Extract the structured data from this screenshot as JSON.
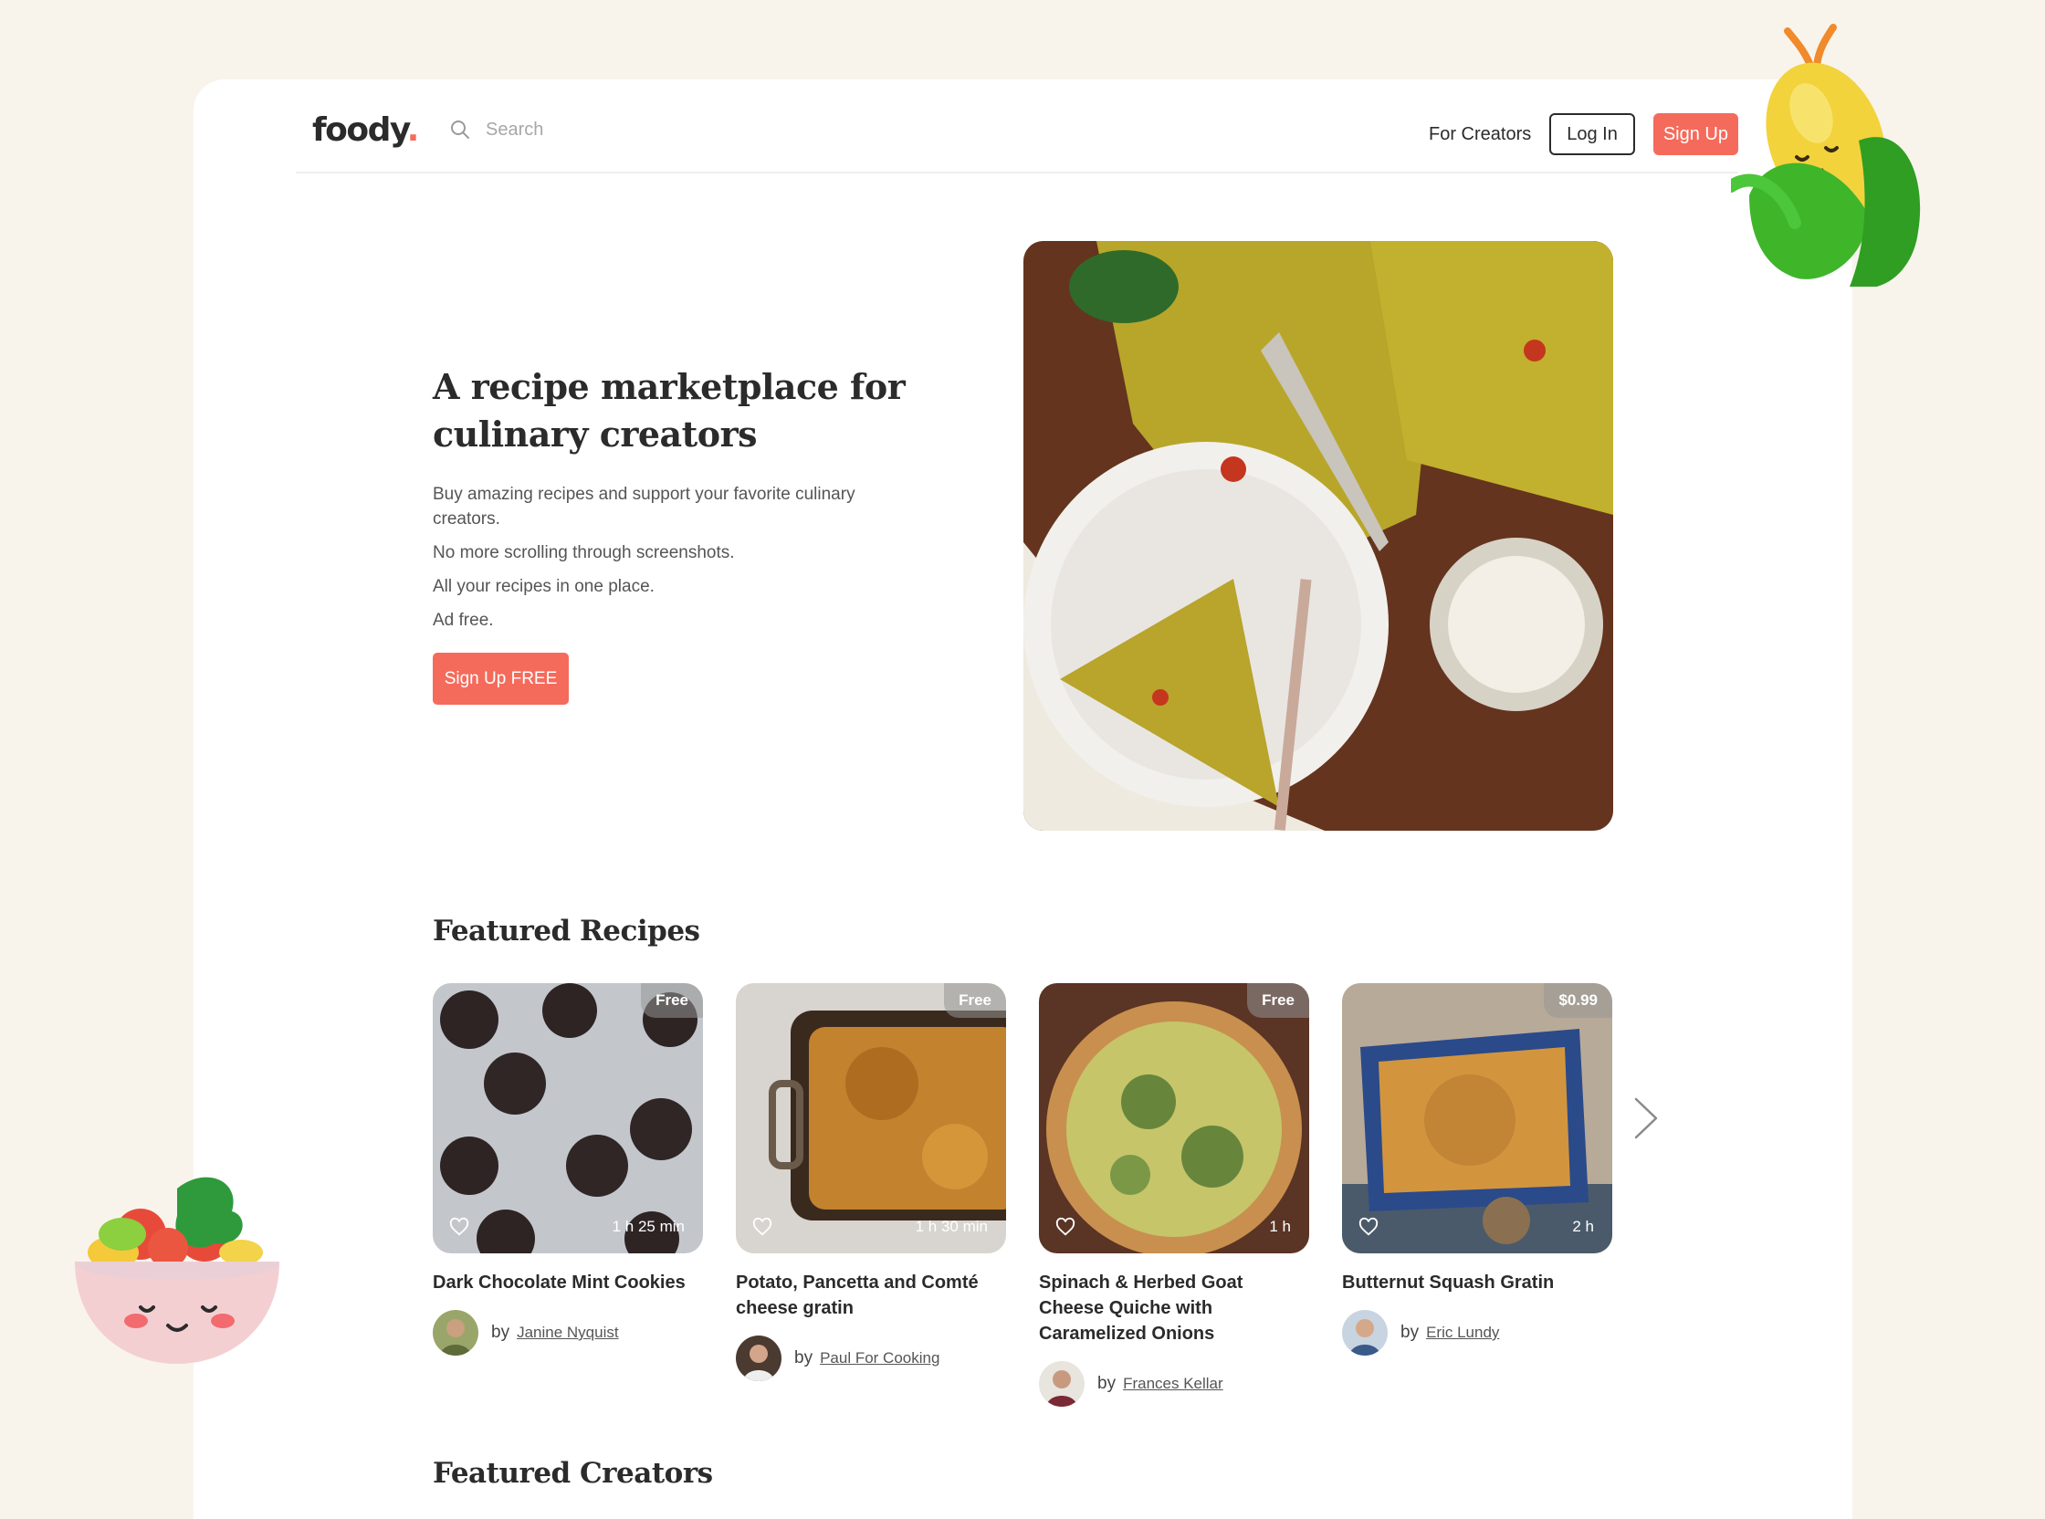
{
  "brand": {
    "name": "foody",
    "dot": "."
  },
  "header": {
    "search_placeholder": "Search",
    "for_creators": "For Creators",
    "login": "Log In",
    "signup": "Sign Up"
  },
  "hero": {
    "title": "A recipe marketplace for culinary creators",
    "lines": [
      "Buy amazing recipes and support your favorite culinary creators.",
      "No more scrolling through screenshots.",
      "All your recipes in one place.",
      "Ad free."
    ],
    "cta": "Sign Up FREE"
  },
  "featured_recipes": {
    "title": "Featured Recipes",
    "by": "by",
    "items": [
      {
        "title": "Dark Chocolate Mint Cookies",
        "price": "Free",
        "duration": "1 h 25 min",
        "author": "Janine Nyquist"
      },
      {
        "title": "Potato, Pancetta and Comté cheese gratin",
        "price": "Free",
        "duration": "1 h 30 min",
        "author": "Paul For Cooking"
      },
      {
        "title": "Spinach & Herbed Goat Cheese Quiche with Caramelized Onions",
        "price": "Free",
        "duration": "1 h",
        "author": "Frances Kellar"
      },
      {
        "title": "Butternut Squash Gratin",
        "price": "$0.99",
        "duration": "2 h",
        "author": "Eric Lundy"
      }
    ]
  },
  "featured_creators": {
    "title": "Featured Creators"
  },
  "colors": {
    "accent": "#f46b5c",
    "background": "#f8f4ec",
    "text": "#2b2b2b"
  },
  "icons": [
    "search-icon",
    "heart-icon",
    "chevron-right-icon"
  ]
}
